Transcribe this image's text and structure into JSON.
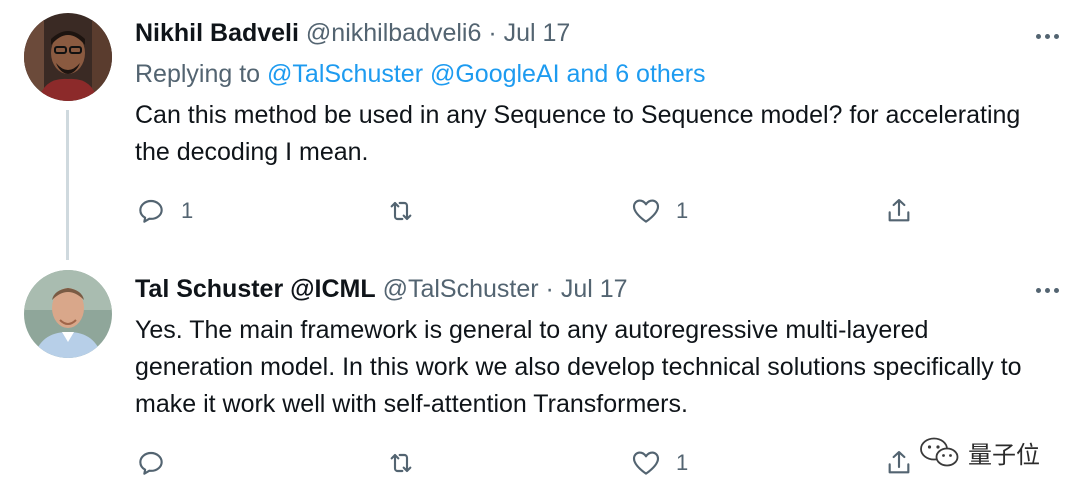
{
  "tweets": [
    {
      "name": "Nikhil Badveli",
      "handle": "@nikhilbadveli6",
      "separator": "·",
      "date": "Jul 17",
      "reply_prefix": "Replying to",
      "reply_mentions": "@TalSchuster @GoogleAI and 6 others",
      "text": "Can this method be used in any Sequence to Sequence model? for accelerating the decoding I mean.",
      "reply_count": "1",
      "retweet_count": "",
      "like_count": "1",
      "avatar_icon": "user-avatar-photo"
    },
    {
      "name": "Tal Schuster @ICML",
      "handle": "@TalSchuster",
      "separator": "·",
      "date": "Jul 17",
      "text": "Yes. The main framework is general to any autoregressive multi-layered generation model. In this work we also develop technical solutions specifically to make it work well with self-attention Transformers.",
      "reply_count": "",
      "retweet_count": "",
      "like_count": "1",
      "avatar_icon": "user-avatar-photo"
    }
  ],
  "watermark": {
    "text": "量子位",
    "icon": "wechat-icon"
  },
  "colors": {
    "secondary": "#536471",
    "link": "#1d9bf0",
    "thread_line": "#cfd9de",
    "text": "#0f1419"
  }
}
